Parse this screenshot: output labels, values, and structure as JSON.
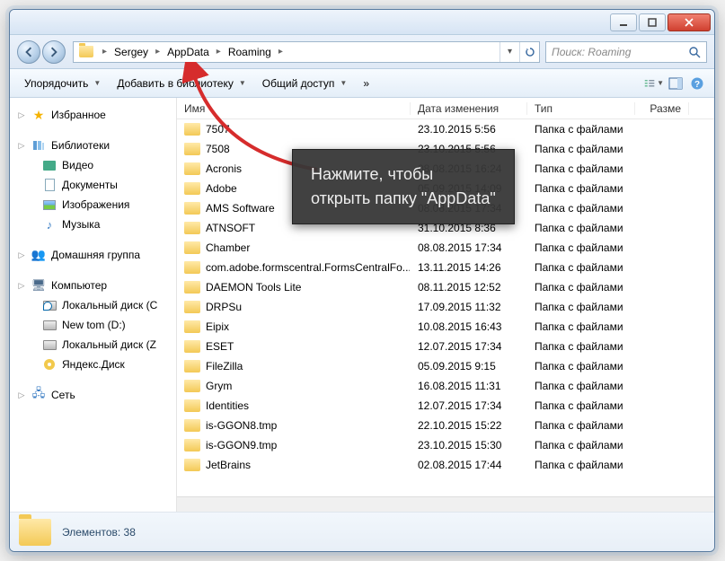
{
  "breadcrumb": {
    "user": "Sergey",
    "appdata": "AppData",
    "roaming": "Roaming"
  },
  "search": {
    "placeholder": "Поиск: Roaming"
  },
  "toolbar": {
    "organize": "Упорядочить",
    "addlib": "Добавить в библиотеку",
    "share": "Общий доступ",
    "more": "»"
  },
  "columns": {
    "name": "Имя",
    "date": "Дата изменения",
    "type": "Тип",
    "size": "Разме"
  },
  "sidebar": {
    "favorites": "Избранное",
    "libraries": "Библиотеки",
    "video": "Видео",
    "documents": "Документы",
    "images": "Изображения",
    "music": "Музыка",
    "homegroup": "Домашняя группа",
    "computer": "Компьютер",
    "driveC": "Локальный диск (C",
    "driveD": "New tom (D:)",
    "driveZ": "Локальный диск (Z",
    "yandex": "Яндекс.Диск",
    "network": "Сеть"
  },
  "typestr": "Папка с файлами",
  "files": [
    {
      "name": "7507",
      "date": "23.10.2015 5:56"
    },
    {
      "name": "7508",
      "date": "23.10.2015 5:56"
    },
    {
      "name": "Acronis",
      "date": "08.08.2015 16:24"
    },
    {
      "name": "Adobe",
      "date": "05.09.2015 14:09"
    },
    {
      "name": "AMS Software",
      "date": "08.08.2015 17:34"
    },
    {
      "name": "ATNSOFT",
      "date": "31.10.2015 8:36"
    },
    {
      "name": "Chamber",
      "date": "08.08.2015 17:34"
    },
    {
      "name": "com.adobe.formscentral.FormsCentralFo...",
      "date": "13.11.2015 14:26"
    },
    {
      "name": "DAEMON Tools Lite",
      "date": "08.11.2015 12:52"
    },
    {
      "name": "DRPSu",
      "date": "17.09.2015 11:32"
    },
    {
      "name": "Eipix",
      "date": "10.08.2015 16:43"
    },
    {
      "name": "ESET",
      "date": "12.07.2015 17:34"
    },
    {
      "name": "FileZilla",
      "date": "05.09.2015 9:15"
    },
    {
      "name": "Grym",
      "date": "16.08.2015 11:31"
    },
    {
      "name": "Identities",
      "date": "12.07.2015 17:34"
    },
    {
      "name": "is-GGON8.tmp",
      "date": "22.10.2015 15:22"
    },
    {
      "name": "is-GGON9.tmp",
      "date": "23.10.2015 15:30"
    },
    {
      "name": "JetBrains",
      "date": "02.08.2015 17:44"
    }
  ],
  "status": {
    "elements_label": "Элементов:",
    "elements_count": "38"
  },
  "tooltip": {
    "line1": "Нажмите, чтобы",
    "line2": "открыть папку \"AppData\""
  }
}
